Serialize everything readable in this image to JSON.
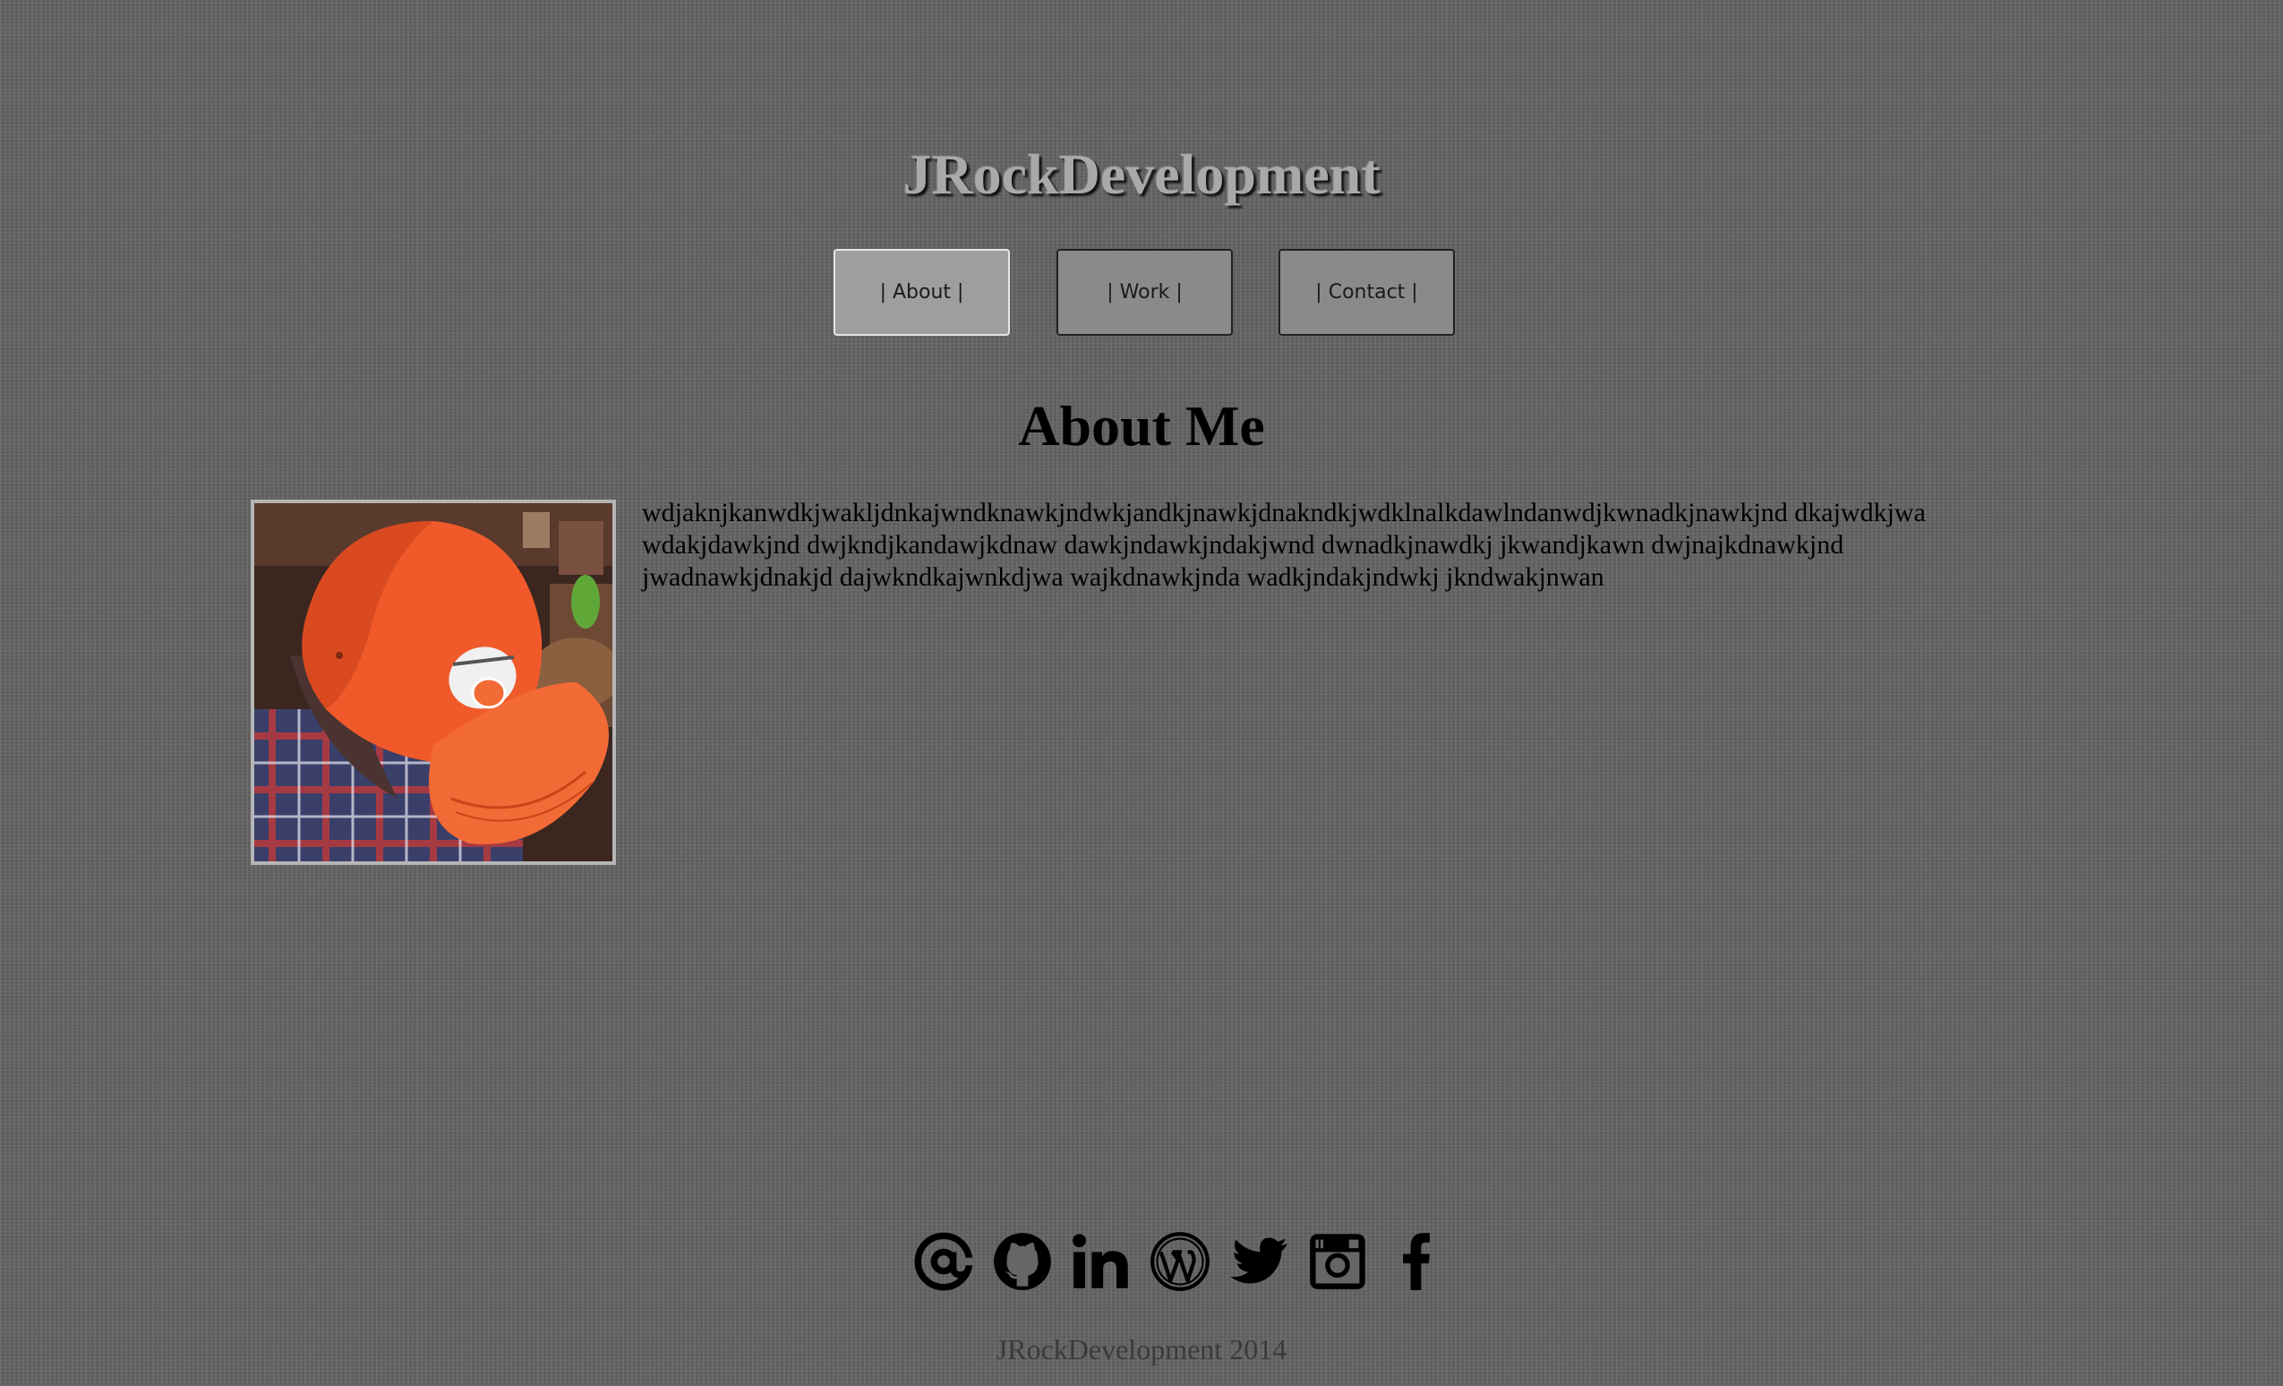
{
  "header": {
    "site_title": "JRockDevelopment"
  },
  "nav": {
    "items": [
      {
        "label": "| About |",
        "active": true
      },
      {
        "label": "| Work |",
        "active": false
      },
      {
        "label": "| Contact |",
        "active": false
      }
    ]
  },
  "about": {
    "heading": "About Me",
    "bio": "wdjaknjkanwdkjwakljdnkajwndknawkjndwkjandkjnawkjdnakndkjwdklnalkdawlndanwdjkwnadkjnawkjnd dkajwdkjwa wdakjdawkjnd dwjkndjkandawjkdnaw dawkjndawkjndakjwnd dwnadkjnawdkj jkwandjkawn dwjnajkdnawkjnd jwadnawkjdnakjd dajwkndkajwnkdjwa wajkdnawkjnda wadkjndakjndwkj jkndwakjnwan",
    "photo_icon": "profile-photo-orange-cap"
  },
  "social": {
    "icons": [
      "at-email-icon",
      "github-icon",
      "linkedin-icon",
      "wordpress-icon",
      "twitter-icon",
      "instagram-icon",
      "facebook-icon"
    ]
  },
  "footer": {
    "text": "JRockDevelopment 2014"
  },
  "colors": {
    "background": "#666666",
    "title_text": "#a9a9a9",
    "nav_button": "#8a8a8a",
    "nav_button_active": "#9e9e9e",
    "cap_orange": "#f05a2a"
  }
}
